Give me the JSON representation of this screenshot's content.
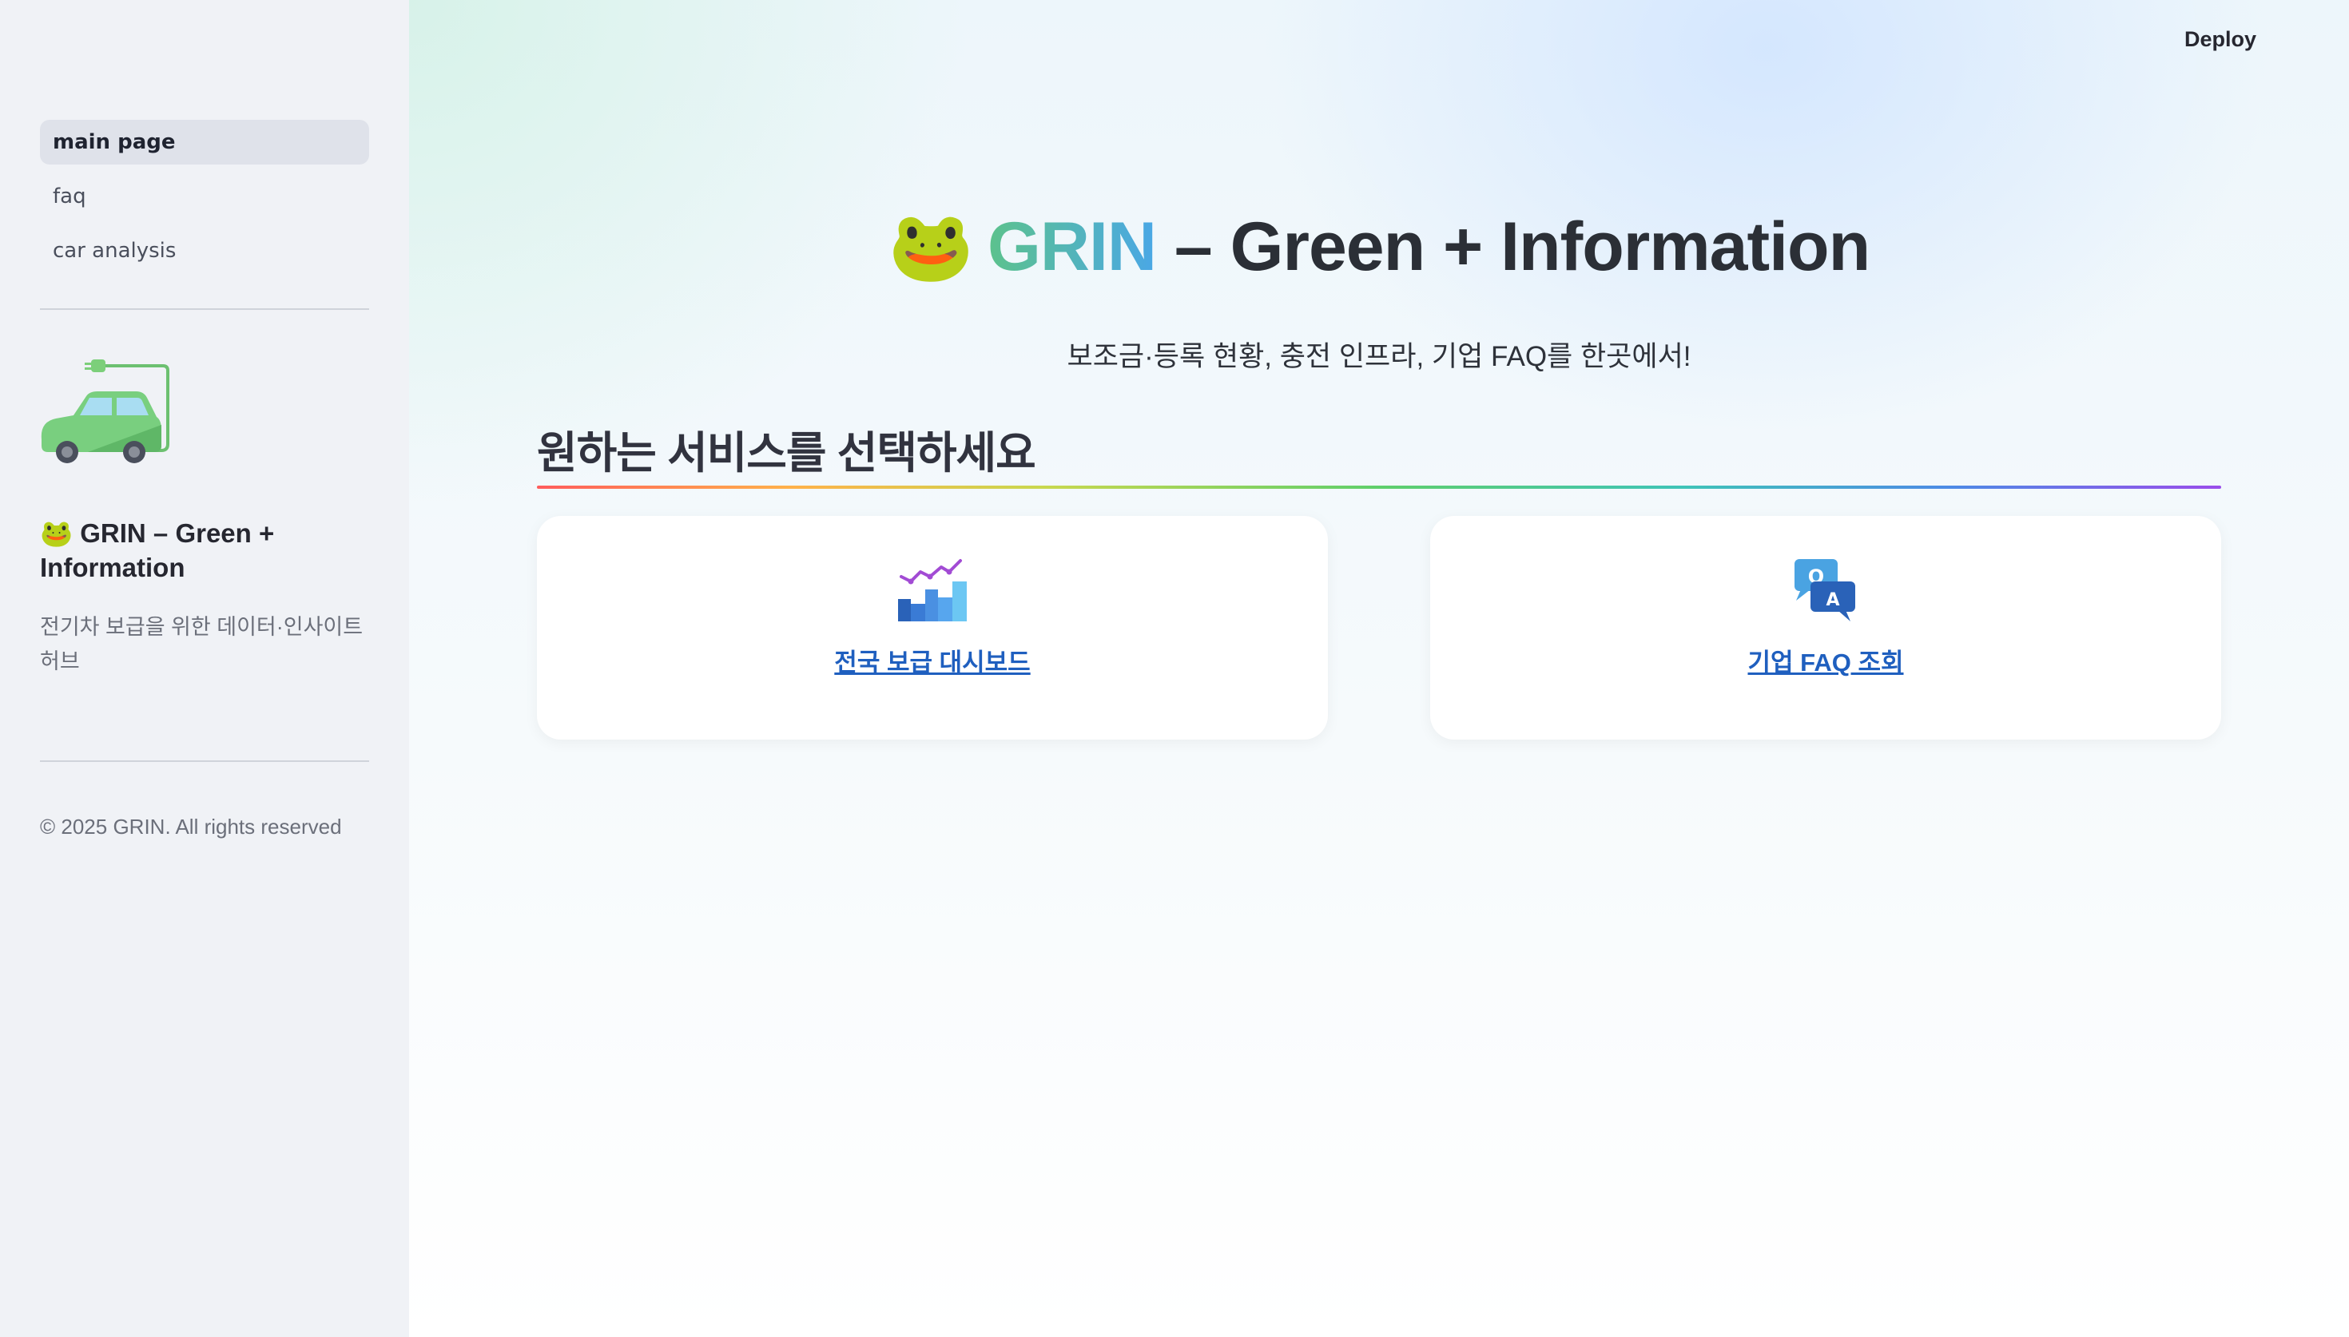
{
  "header": {
    "deploy_label": "Deploy"
  },
  "sidebar": {
    "nav": [
      {
        "label": "main page",
        "active": true
      },
      {
        "label": "faq",
        "active": false
      },
      {
        "label": "car analysis",
        "active": false
      }
    ],
    "logo_icon": "electric-car-icon",
    "title": "🐸 GRIN – Green + Information",
    "subtitle": "전기차 보급을 위한 데이터·인사이트 허브",
    "footer": "© 2025 GRIN. All rights reserved"
  },
  "main": {
    "hero": {
      "emoji": "🐸",
      "brand": "GRIN",
      "rest": " – Green + Information"
    },
    "tagline": "보조금·등록 현황, 충전 인프라, 기업 FAQ를 한곳에서!",
    "section_title": "원하는 서비스를 선택하세요",
    "cards": [
      {
        "icon": "chart-icon",
        "label": "전국 보급 대시보드"
      },
      {
        "icon": "qa-icon",
        "label": "기업 FAQ 조회"
      }
    ]
  },
  "colors": {
    "sidebar_bg": "#f0f2f6",
    "brand_gradient_start": "#5cc28c",
    "brand_gradient_end": "#4aa7e6",
    "link": "#1f5fbf"
  }
}
